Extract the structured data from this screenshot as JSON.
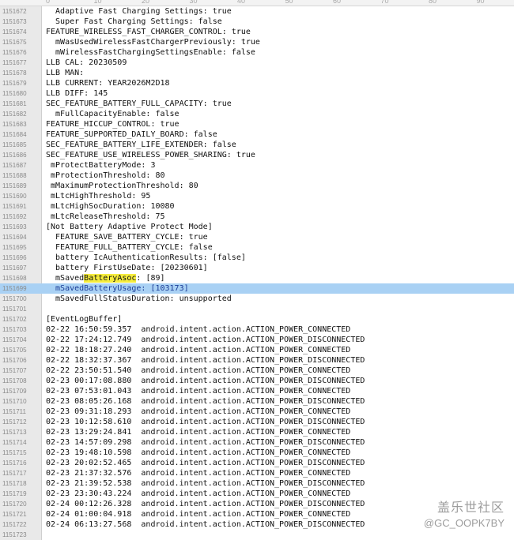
{
  "ruler": {
    "marks": [
      "0",
      "10",
      "20",
      "30",
      "40",
      "50",
      "60",
      "70",
      "80",
      "90"
    ]
  },
  "lines": [
    {
      "n": "1151672",
      "t": "  Adaptive Fast Charging Settings: true"
    },
    {
      "n": "1151673",
      "t": "  Super Fast Charging Settings: false"
    },
    {
      "n": "1151674",
      "t": "FEATURE_WIRELESS_FAST_CHARGER_CONTROL: true"
    },
    {
      "n": "1151675",
      "t": "  mWasUsedWirelessFastChargerPreviously: true"
    },
    {
      "n": "1151676",
      "t": "  mWirelessFastChargingSettingsEnable: false"
    },
    {
      "n": "1151677",
      "t": "LLB CAL: 20230509"
    },
    {
      "n": "1151678",
      "t": "LLB MAN:"
    },
    {
      "n": "1151679",
      "t": "LLB CURRENT: YEAR2026M2D18"
    },
    {
      "n": "1151680",
      "t": "LLB DIFF: 145"
    },
    {
      "n": "1151681",
      "t": "SEC_FEATURE_BATTERY_FULL_CAPACITY: true"
    },
    {
      "n": "1151682",
      "t": "  mFullCapacityEnable: false"
    },
    {
      "n": "1151683",
      "t": "FEATURE_HICCUP_CONTROL: true"
    },
    {
      "n": "1151684",
      "t": "FEATURE_SUPPORTED_DAILY_BOARD: false"
    },
    {
      "n": "1151685",
      "t": "SEC_FEATURE_BATTERY_LIFE_EXTENDER: false"
    },
    {
      "n": "1151686",
      "t": "SEC_FEATURE_USE_WIRELESS_POWER_SHARING: true"
    },
    {
      "n": "1151687",
      "t": " mProtectBatteryMode: 3"
    },
    {
      "n": "1151688",
      "t": " mProtectionThreshold: 80"
    },
    {
      "n": "1151689",
      "t": " mMaximumProtectionThreshold: 80"
    },
    {
      "n": "1151690",
      "t": " mLtcHighThreshold: 95"
    },
    {
      "n": "1151691",
      "t": " mLtcHighSocDuration: 10080"
    },
    {
      "n": "1151692",
      "t": " mLtcReleaseThreshold: 75"
    },
    {
      "n": "1151693",
      "t": "[Not Battery Adaptive Protect Mode]"
    },
    {
      "n": "1151694",
      "t": "  FEATURE_SAVE_BATTERY_CYCLE: true"
    },
    {
      "n": "1151695",
      "t": "  FEATURE_FULL_BATTERY_CYCLE: false"
    },
    {
      "n": "1151696",
      "t": "  battery IcAuthenticationResults: [false]"
    },
    {
      "n": "1151697",
      "t": "  battery FirstUseDate: [20230601]"
    },
    {
      "n": "1151698",
      "pre": "  mSaved",
      "hl": "BatteryAsoc",
      "post": ": [89]"
    },
    {
      "n": "1151699",
      "t": "  mSavedBatteryUsage: [103173]",
      "selected": true
    },
    {
      "n": "1151700",
      "t": "  mSavedFullStatusDuration: unsupported"
    },
    {
      "n": "1151701",
      "t": ""
    },
    {
      "n": "1151702",
      "t": "[EventLogBuffer]"
    },
    {
      "n": "1151703",
      "t": "02-22 16:50:59.357  android.intent.action.ACTION_POWER_CONNECTED"
    },
    {
      "n": "1151704",
      "t": "02-22 17:24:12.749  android.intent.action.ACTION_POWER_DISCONNECTED"
    },
    {
      "n": "1151705",
      "t": "02-22 18:18:27.240  android.intent.action.ACTION_POWER_CONNECTED"
    },
    {
      "n": "1151706",
      "t": "02-22 18:32:37.367  android.intent.action.ACTION_POWER_DISCONNECTED"
    },
    {
      "n": "1151707",
      "t": "02-22 23:50:51.540  android.intent.action.ACTION_POWER_CONNECTED"
    },
    {
      "n": "1151708",
      "t": "02-23 00:17:08.880  android.intent.action.ACTION_POWER_DISCONNECTED"
    },
    {
      "n": "1151709",
      "t": "02-23 07:53:01.043  android.intent.action.ACTION_POWER_CONNECTED"
    },
    {
      "n": "1151710",
      "t": "02-23 08:05:26.168  android.intent.action.ACTION_POWER_DISCONNECTED"
    },
    {
      "n": "1151711",
      "t": "02-23 09:31:18.293  android.intent.action.ACTION_POWER_CONNECTED"
    },
    {
      "n": "1151712",
      "t": "02-23 10:12:58.610  android.intent.action.ACTION_POWER_DISCONNECTED"
    },
    {
      "n": "1151713",
      "t": "02-23 13:29:24.841  android.intent.action.ACTION_POWER_CONNECTED"
    },
    {
      "n": "1151714",
      "t": "02-23 14:57:09.298  android.intent.action.ACTION_POWER_DISCONNECTED"
    },
    {
      "n": "1151715",
      "t": "02-23 19:48:10.598  android.intent.action.ACTION_POWER_CONNECTED"
    },
    {
      "n": "1151716",
      "t": "02-23 20:02:52.465  android.intent.action.ACTION_POWER_DISCONNECTED"
    },
    {
      "n": "1151717",
      "t": "02-23 21:37:32.576  android.intent.action.ACTION_POWER_CONNECTED"
    },
    {
      "n": "1151718",
      "t": "02-23 21:39:52.538  android.intent.action.ACTION_POWER_DISCONNECTED"
    },
    {
      "n": "1151719",
      "t": "02-23 23:30:43.224  android.intent.action.ACTION_POWER_CONNECTED"
    },
    {
      "n": "1151720",
      "t": "02-24 00:12:26.328  android.intent.action.ACTION_POWER_DISCONNECTED"
    },
    {
      "n": "1151721",
      "t": "02-24 01:00:04.918  android.intent.action.ACTION_POWER_CONNECTED"
    },
    {
      "n": "1151722",
      "t": "02-24 06:13:27.568  android.intent.action.ACTION_POWER_DISCONNECTED"
    },
    {
      "n": "1151723",
      "t": ""
    }
  ],
  "colors": {
    "selection": "#a9d1f4",
    "search_highlight": "#f5ec3c",
    "gutter": "#e9e9e9",
    "line_number": "#8a8a8a"
  },
  "watermark": {
    "title": "盖乐世社区",
    "handle": "@GC_OOPK7BY"
  }
}
